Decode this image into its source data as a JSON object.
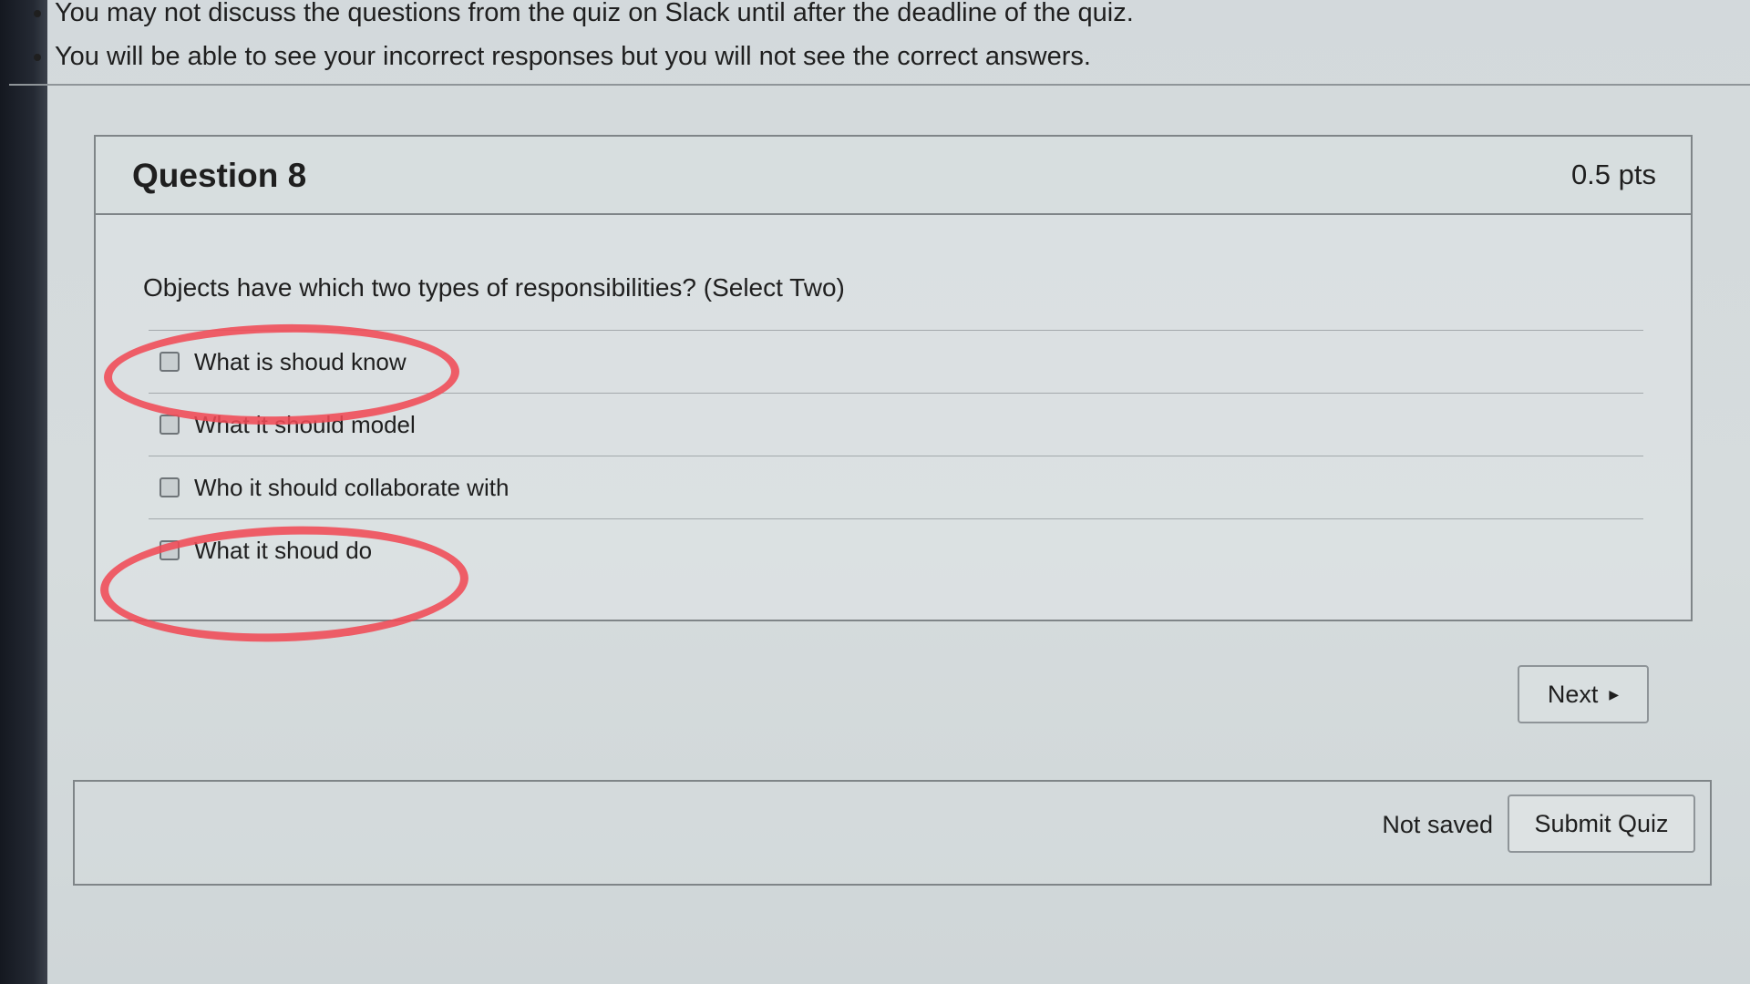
{
  "instructions": {
    "items": [
      "You may not discuss the questions from the quiz on Slack until after the deadline of the quiz.",
      "You will be able to see your incorrect responses but you will not see the correct answers."
    ]
  },
  "question": {
    "title": "Question 8",
    "points": "0.5 pts",
    "text": "Objects have which two types of responsibilities? (Select Two)",
    "answers": [
      {
        "label": "What is shoud know",
        "checked": false,
        "circled": true
      },
      {
        "label": "What it should model",
        "checked": false,
        "circled": false
      },
      {
        "label": "Who it should collaborate with",
        "checked": false,
        "circled": false
      },
      {
        "label": "What it shoud do",
        "checked": false,
        "circled": true
      }
    ]
  },
  "nav": {
    "next_label": "Next",
    "next_icon": "triangle-right-icon"
  },
  "footer": {
    "status": "Not saved",
    "submit_label": "Submit Quiz"
  },
  "colors": {
    "annotation": "#f04a55",
    "background": "#d5dbdd",
    "border": "#7f8588"
  }
}
